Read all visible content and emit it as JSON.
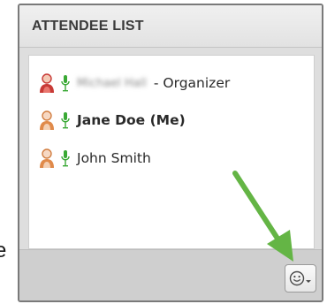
{
  "edge_fragment": "e",
  "panel": {
    "title": "ATTENDEE LIST"
  },
  "attendees": [
    {
      "name": "Michael Hall",
      "suffix": "- Organizer",
      "icon": "person-icon-red",
      "mic": "microphone-icon"
    },
    {
      "name": "Jane Doe (Me)",
      "icon": "person-icon-orange",
      "mic": "microphone-icon"
    },
    {
      "name": "John Smith",
      "icon": "person-icon-orange",
      "mic": "microphone-icon"
    }
  ],
  "footer": {
    "emoji_button_icon": "smiley-icon",
    "dropdown_icon": "chevron-down-icon"
  },
  "colors": {
    "mic_green": "#3aa935",
    "organizer_red": "#c83a36",
    "attendee_orange": "#e08a4a",
    "arrow_green": "#64b545"
  }
}
